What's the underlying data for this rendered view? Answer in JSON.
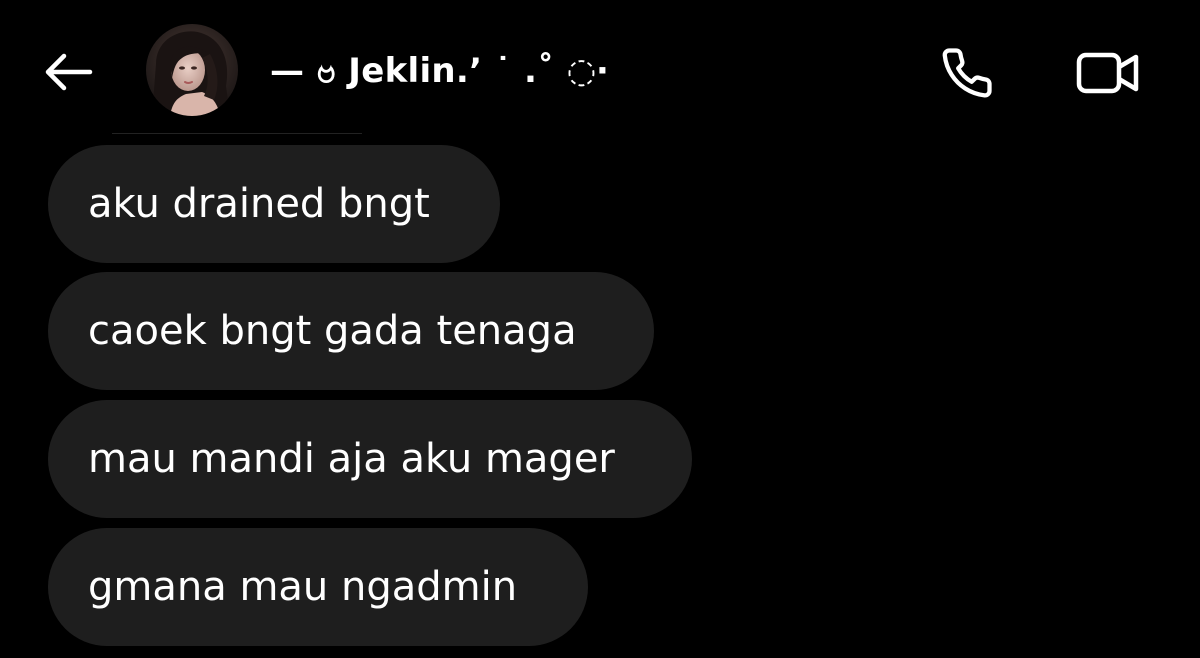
{
  "header": {
    "contact_name": "— ဗ Jeklin.ʼ ˙ .˚ ◌‧"
  },
  "messages": [
    {
      "text": "aku drained bngt"
    },
    {
      "text": "caoek bngt gada tenaga"
    },
    {
      "text": "mau mandi aja aku mager"
    },
    {
      "text": "gmana mau ngadmin"
    }
  ],
  "icons": {
    "back": "arrow-left-icon",
    "call": "phone-icon",
    "video": "video-camera-icon"
  },
  "colors": {
    "background": "#000000",
    "bubble": "#1e1e1e",
    "text": "#ffffff"
  }
}
